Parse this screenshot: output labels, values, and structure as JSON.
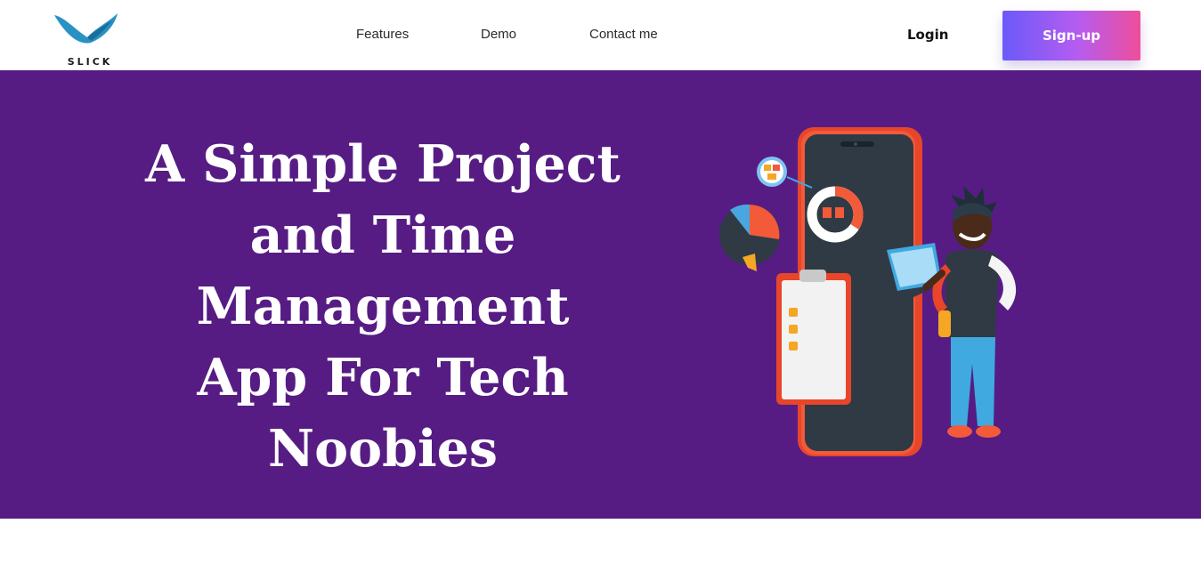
{
  "brand": {
    "logo_text": "SLICK",
    "logo_color": "#2a92c2"
  },
  "nav": {
    "features": "Features",
    "demo": "Demo",
    "contact": "Contact me"
  },
  "auth": {
    "login": "Login",
    "signup": "Sign-up",
    "signup_gradient": [
      "#6a5af9",
      "#b65cf0",
      "#ee4e9a"
    ]
  },
  "hero": {
    "title": "A Simple Project and Time Management App For Tech Noobies",
    "background": "#561c84",
    "illustration": "person-with-laptop-and-phone-dashboard"
  }
}
